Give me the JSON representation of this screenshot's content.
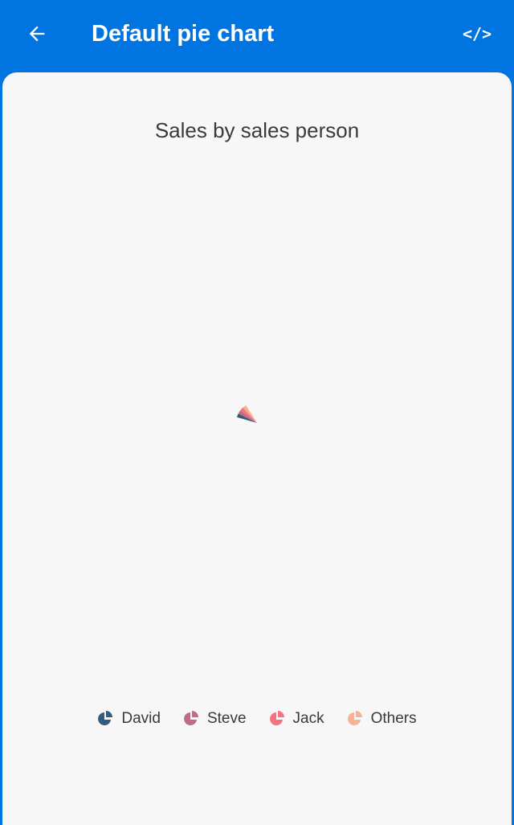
{
  "appbar": {
    "title": "Default pie chart",
    "back_icon": "arrow-left-icon",
    "code_icon": "code-icon",
    "code_label": "</>"
  },
  "colors": {
    "appbar": "#0074e0",
    "background": "#f7f7f8"
  },
  "chart_data": {
    "type": "pie",
    "title": "Sales by sales person",
    "categories": [
      "David",
      "Steve",
      "Jack",
      "Others"
    ],
    "colors": [
      "#355c7d",
      "#c06c84",
      "#f67280",
      "#f8b195"
    ],
    "legend_position": "bottom"
  }
}
